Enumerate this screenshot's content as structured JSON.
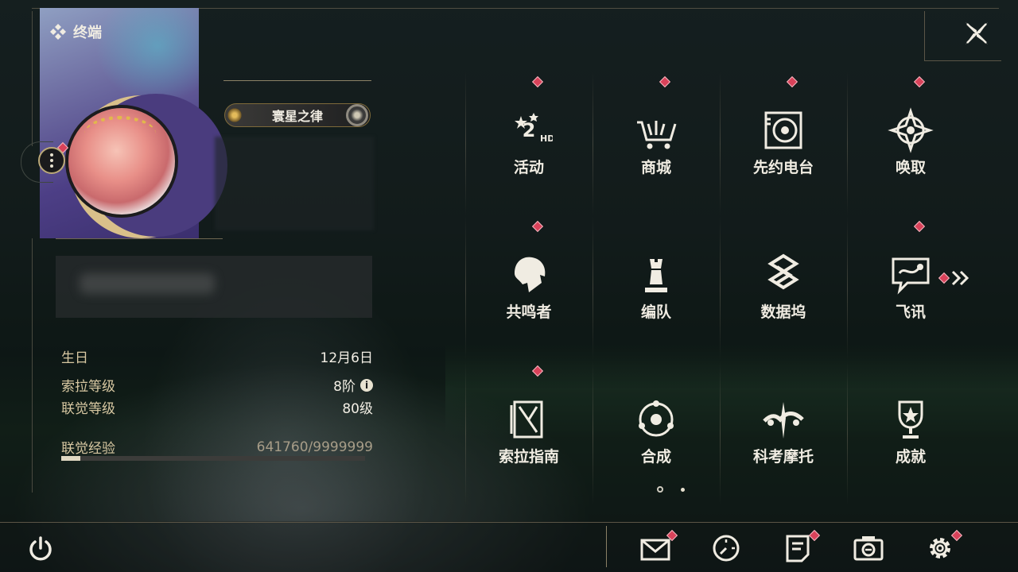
{
  "header": {
    "terminal_label": "终端",
    "terminal_icon": "diamond-cluster-icon",
    "close_icon": "close-icon"
  },
  "profile": {
    "title_badge": "寰星之律",
    "stats": [
      {
        "label": "生日",
        "value": "12月6日"
      },
      {
        "label": "索拉等级",
        "value": "8阶",
        "info": "i"
      },
      {
        "label": "联觉等级",
        "value": "80级"
      },
      {
        "label": "联觉经验",
        "value": "641760/9999999"
      }
    ],
    "exp_fraction": 0.064
  },
  "menu": {
    "items": [
      {
        "label": "活动",
        "icon": "activity-2nd-icon",
        "badge": true
      },
      {
        "label": "商城",
        "icon": "shop-cart-icon",
        "badge": true
      },
      {
        "label": "先约电台",
        "icon": "radio-icon",
        "badge": true
      },
      {
        "label": "唤取",
        "icon": "convene-compass-icon",
        "badge": true
      },
      {
        "label": "共鸣者",
        "icon": "resonator-head-icon",
        "badge": true
      },
      {
        "label": "编队",
        "icon": "chess-team-icon",
        "badge": false
      },
      {
        "label": "数据坞",
        "icon": "data-bank-icon",
        "badge": false
      },
      {
        "label": "飞讯",
        "icon": "chat-message-icon",
        "badge": true
      },
      {
        "label": "索拉指南",
        "icon": "guide-book-icon",
        "badge": true
      },
      {
        "label": "合成",
        "icon": "synthesis-icon",
        "badge": false
      },
      {
        "label": "科考摩托",
        "icon": "motorcycle-icon",
        "badge": false
      },
      {
        "label": "成就",
        "icon": "trophy-icon",
        "badge": false
      }
    ],
    "page_indicator": {
      "current": 1,
      "total": 2
    },
    "next_page_icon": "double-chevron-right-icon"
  },
  "bottom_bar": {
    "icons": [
      {
        "name": "power-icon",
        "badge": false
      },
      {
        "name": "mail-icon",
        "badge": true
      },
      {
        "name": "clock-icon",
        "badge": false
      },
      {
        "name": "notes-icon",
        "badge": true
      },
      {
        "name": "camera-icon",
        "badge": true
      },
      {
        "name": "settings-gear-icon",
        "badge": true
      }
    ]
  }
}
